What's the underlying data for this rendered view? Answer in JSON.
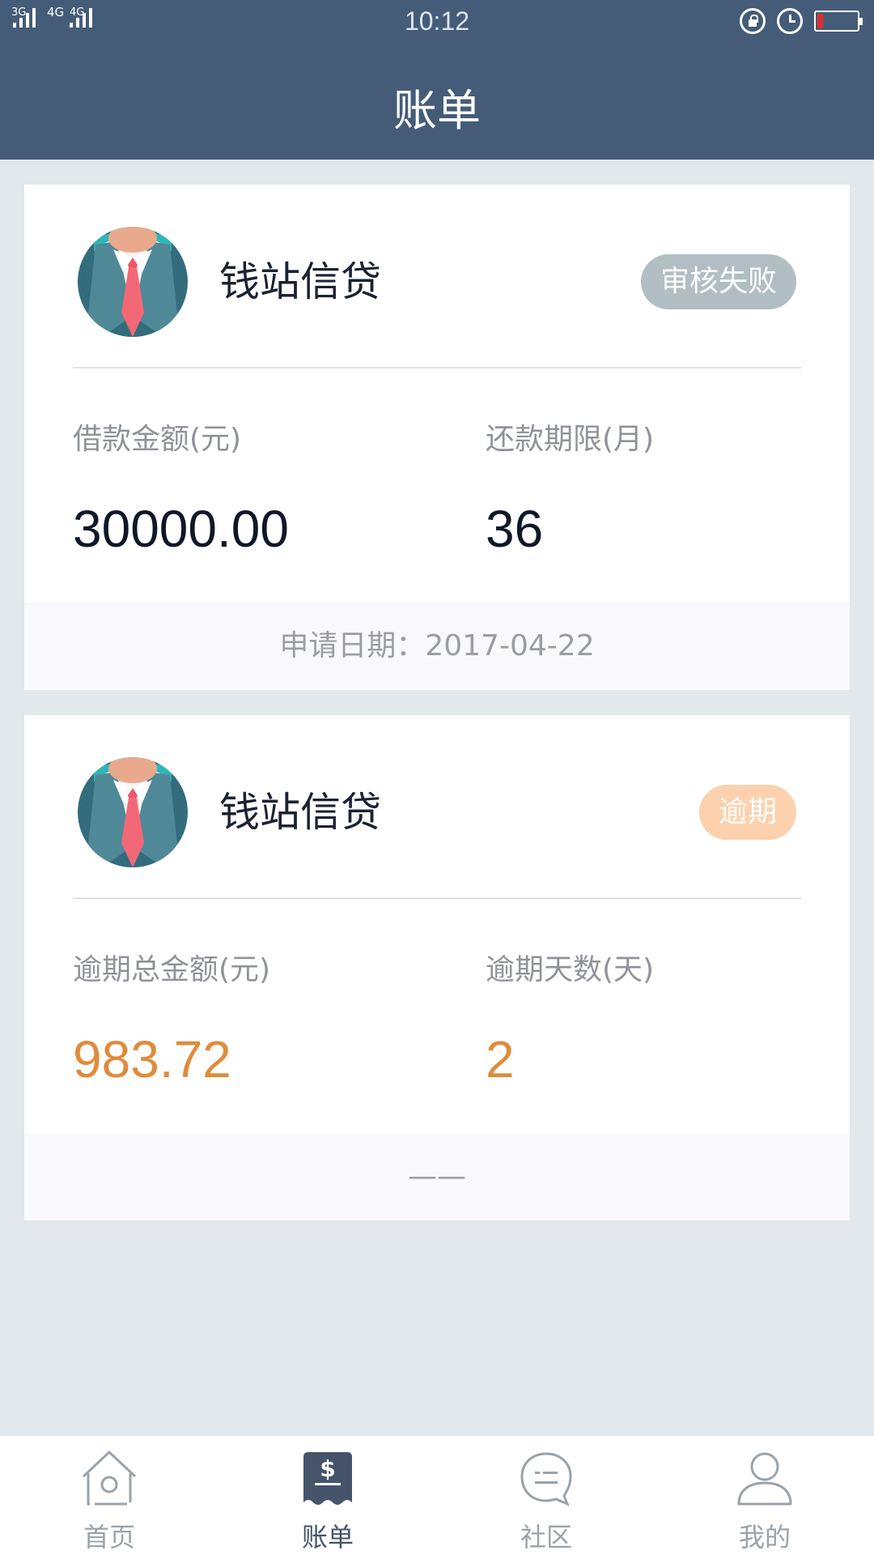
{
  "status_bar": {
    "net1": "3G",
    "net2": "4G",
    "net3": "4G",
    "time": "10:12",
    "battery_color": "#e52b2b"
  },
  "header": {
    "title": "账单"
  },
  "bills": [
    {
      "lender": "钱站信贷",
      "status": "审核失败",
      "status_color": "#b1bec3",
      "left_label": "借款金额(元)",
      "left_value": "30000.00",
      "right_label": "还款期限(月)",
      "right_value": "36",
      "footer": "申请日期：2017-04-22"
    },
    {
      "lender": "钱站信贷",
      "status": "逾期",
      "status_color": "#fdd1ae",
      "left_label": "逾期总金额(元)",
      "left_value": "983.72",
      "right_label": "逾期天数(天)",
      "right_value": "2",
      "value_color": "#e08b3b",
      "footer": "——"
    }
  ],
  "tabbar": {
    "items": [
      {
        "label": "首页",
        "icon": "home-icon",
        "active": false
      },
      {
        "label": "账单",
        "icon": "bill-icon",
        "active": true
      },
      {
        "label": "社区",
        "icon": "chat-icon",
        "active": false
      },
      {
        "label": "我的",
        "icon": "person-icon",
        "active": false
      }
    ]
  }
}
